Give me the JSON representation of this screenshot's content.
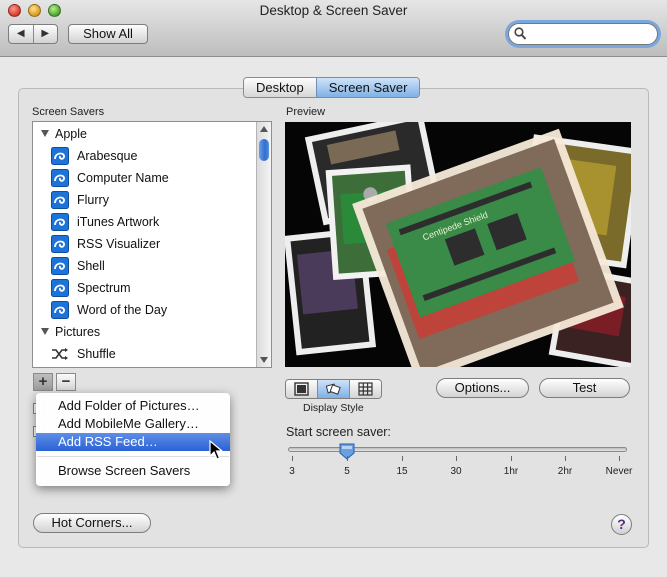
{
  "window": {
    "title": "Desktop & Screen Saver",
    "back_icon": "◀",
    "forward_icon": "▶",
    "show_all_label": "Show All",
    "search_value": ""
  },
  "tabs": [
    {
      "label": "Desktop",
      "active": false
    },
    {
      "label": "Screen Saver",
      "active": true
    }
  ],
  "sidebar": {
    "label": "Screen Savers",
    "groups": [
      {
        "label": "Apple",
        "items": [
          "Arabesque",
          "Computer Name",
          "Flurry",
          "iTunes Artwork",
          "RSS Visualizer",
          "Shell",
          "Spectrum",
          "Word of the Day"
        ]
      },
      {
        "label": "Pictures",
        "items": [
          "Shuffle"
        ]
      }
    ],
    "add_label": "+",
    "remove_label": "−"
  },
  "add_menu": {
    "items": [
      {
        "label": "Add Folder of Pictures…",
        "highlighted": false
      },
      {
        "label": "Add MobileMe Gallery…",
        "highlighted": false
      },
      {
        "label": "Add RSS Feed…",
        "highlighted": true
      },
      {
        "label": "Browse Screen Savers",
        "highlighted": false
      }
    ]
  },
  "preview": {
    "label": "Preview",
    "display_style_label": "Display Style",
    "display_styles": [
      "slideshow-icon",
      "collage-icon",
      "mosaic-icon"
    ],
    "active_display_style": 1
  },
  "buttons": {
    "options": "Options...",
    "test": "Test",
    "hot_corners": "Hot Corners...",
    "help": "?"
  },
  "start_slider": {
    "label": "Start screen saver:",
    "ticks": [
      "3",
      "5",
      "15",
      "30",
      "1hr",
      "2hr",
      "Never"
    ],
    "value": "5"
  },
  "colors": {
    "accent": "#3b73d6",
    "highlight_start": "#5f8ee6",
    "highlight_end": "#2a62d6"
  }
}
